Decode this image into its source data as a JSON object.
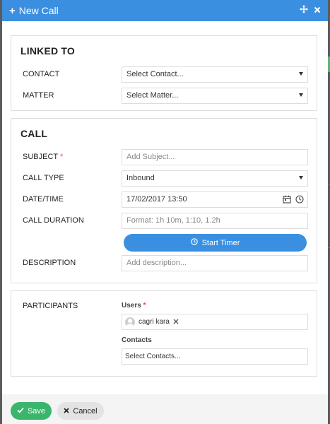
{
  "header": {
    "title": "New Call"
  },
  "linked_to": {
    "title": "LINKED TO",
    "contact": {
      "label": "CONTACT",
      "placeholder": "Select Contact..."
    },
    "matter": {
      "label": "MATTER",
      "placeholder": "Select Matter..."
    }
  },
  "call": {
    "title": "CALL",
    "subject": {
      "label": "SUBJECT",
      "required": "*",
      "placeholder": "Add Subject..."
    },
    "call_type": {
      "label": "CALL TYPE",
      "value": "Inbound"
    },
    "datetime": {
      "label": "DATE/TIME",
      "value": "17/02/2017 13:50"
    },
    "duration": {
      "label": "CALL DURATION",
      "placeholder": "Format: 1h 10m, 1:10, 1.2h"
    },
    "start_timer_label": "Start Timer",
    "description": {
      "label": "DESCRIPTION",
      "placeholder": "Add description..."
    }
  },
  "participants": {
    "label": "PARTICIPANTS",
    "users_label": "Users",
    "users_required": "*",
    "user_tags": [
      "cagri kara"
    ],
    "contacts_label": "Contacts",
    "contacts_placeholder": "Select Contacts..."
  },
  "footer": {
    "save_label": "Save",
    "cancel_label": "Cancel"
  },
  "colors": {
    "primary": "#3b8fe0",
    "success": "#3bb56b",
    "required": "#d9534f"
  },
  "icons": [
    "plus-icon",
    "move-icon",
    "close-icon",
    "calendar-icon",
    "clock-icon",
    "check-icon",
    "x-icon",
    "user-avatar-icon",
    "caret-down-icon"
  ]
}
